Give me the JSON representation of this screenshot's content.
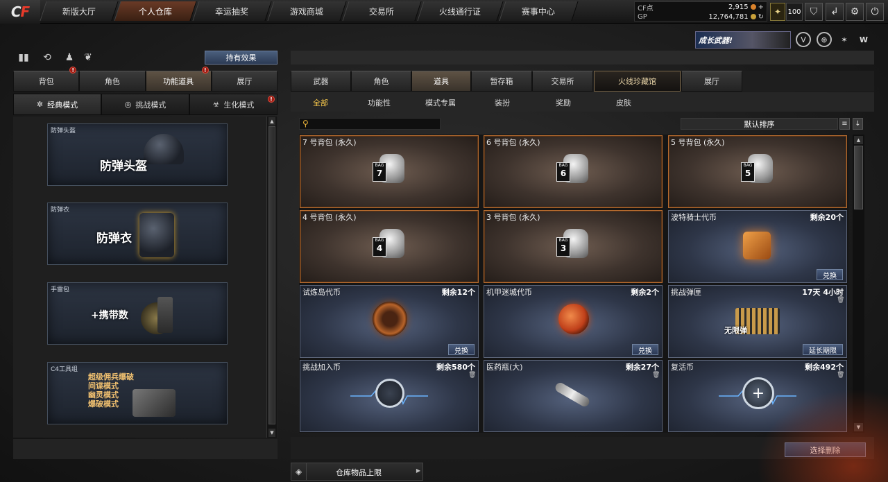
{
  "topbar": {
    "logo_main": "C",
    "logo_accent": "F",
    "tabs": [
      {
        "label": "新版大厅"
      },
      {
        "label": "个人仓库",
        "active": true
      },
      {
        "label": "幸运抽奖"
      },
      {
        "label": "游戏商城"
      },
      {
        "label": "交易所"
      },
      {
        "label": "火线通行证"
      },
      {
        "label": "赛事中心"
      }
    ],
    "currency": {
      "cf_label": "CF点",
      "cf_value": "2,915",
      "gp_label": "GP",
      "gp_value": "12,764,781"
    },
    "level": "100",
    "icons": [
      "rank-icon",
      "medal-icon",
      "exit-icon",
      "settings-icon",
      "power-icon"
    ]
  },
  "promo": {
    "label": "成长武器!"
  },
  "left": {
    "effect_button": "持有效果",
    "tabs": [
      {
        "label": "背包"
      },
      {
        "label": "角色"
      },
      {
        "label": "功能道具",
        "active": true
      },
      {
        "label": "展厅"
      }
    ],
    "modes": [
      {
        "label": "经典模式",
        "active": true
      },
      {
        "label": "挑战模式"
      },
      {
        "label": "生化模式"
      }
    ],
    "cards": [
      {
        "caption": "防弹头盔",
        "text": "防弹头盔"
      },
      {
        "caption": "防弹衣",
        "text": "防弹衣"
      },
      {
        "caption": "手雷包",
        "text": "+携带数"
      },
      {
        "caption": "C4工具组",
        "lines": [
          "超级佣兵爆破",
          "间谍模式",
          "幽灵模式",
          "爆破模式"
        ]
      }
    ]
  },
  "right": {
    "tabs": [
      {
        "label": "武器"
      },
      {
        "label": "角色"
      },
      {
        "label": "道具",
        "active": true
      },
      {
        "label": "暂存箱"
      },
      {
        "label": "交易所"
      },
      {
        "label": "火线珍藏馆",
        "special": true
      },
      {
        "label": "展厅"
      }
    ],
    "subtabs": [
      {
        "label": "全部",
        "active": true
      },
      {
        "label": "功能性"
      },
      {
        "label": "模式专属"
      },
      {
        "label": "装扮"
      },
      {
        "label": "奖励"
      },
      {
        "label": "皮肤"
      }
    ],
    "search_placeholder": "",
    "sort_label": "默认排序",
    "items": [
      {
        "title": "7 号背包 (永久)",
        "kind": "bag",
        "bag_no": "7"
      },
      {
        "title": "6 号背包 (永久)",
        "kind": "bag",
        "bag_no": "6"
      },
      {
        "title": "5 号背包 (永久)",
        "kind": "bag",
        "bag_no": "5"
      },
      {
        "title": "4 号背包 (永久)",
        "kind": "bag",
        "bag_no": "4"
      },
      {
        "title": "3 号背包 (永久)",
        "kind": "bag",
        "bag_no": "3"
      },
      {
        "title": "波特骑士代币",
        "qty": "剩余20个",
        "action": "兑换",
        "kind": "box"
      },
      {
        "title": "试炼岛代币",
        "qty": "剩余12个",
        "action": "兑换",
        "kind": "coin-orange"
      },
      {
        "title": "机甲迷城代币",
        "qty": "剩余2个",
        "action": "兑换",
        "kind": "coin-red"
      },
      {
        "title": "挑战弹匣",
        "qty": "17天 4小时",
        "action": "延长期限",
        "kind": "ammo",
        "trash": true
      },
      {
        "title": "挑战加入币",
        "qty": "剩余580个",
        "kind": "pulse",
        "trash": true
      },
      {
        "title": "医药瓶(大)",
        "qty": "剩余27个",
        "kind": "syringe",
        "trash": true
      },
      {
        "title": "复活币",
        "qty": "剩余492个",
        "kind": "revive",
        "trash": true
      }
    ],
    "bag_tag": "BAG",
    "ammo_overlay": "无限弹",
    "delete_button": "选择删除",
    "capacity_label": "仓库物品上限"
  }
}
